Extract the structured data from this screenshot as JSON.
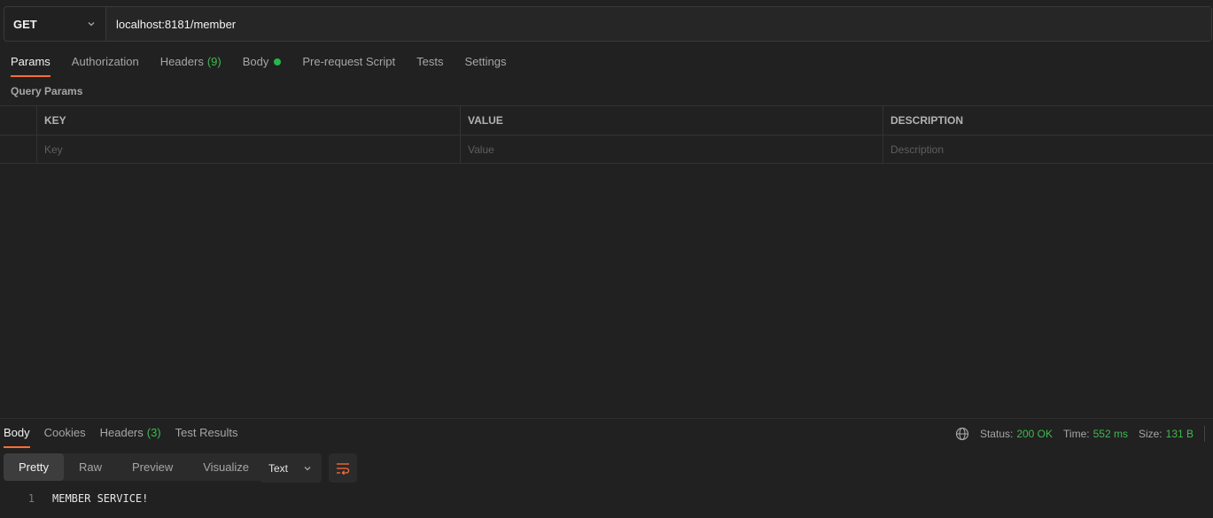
{
  "request": {
    "method": "GET",
    "url": "localhost:8181/member"
  },
  "request_tabs": [
    {
      "label": "Params"
    },
    {
      "label": "Authorization"
    },
    {
      "label": "Headers",
      "count": "(9)"
    },
    {
      "label": "Body"
    },
    {
      "label": "Pre-request Script"
    },
    {
      "label": "Tests"
    },
    {
      "label": "Settings"
    }
  ],
  "query_params": {
    "title": "Query Params",
    "headers": {
      "key": "KEY",
      "value": "VALUE",
      "description": "DESCRIPTION"
    },
    "placeholders": {
      "key": "Key",
      "value": "Value",
      "description": "Description"
    }
  },
  "response_tabs": [
    {
      "label": "Body"
    },
    {
      "label": "Cookies"
    },
    {
      "label": "Headers",
      "count": "(3)"
    },
    {
      "label": "Test Results"
    }
  ],
  "status": {
    "status_label": "Status:",
    "status_value": "200 OK",
    "time_label": "Time:",
    "time_value": "552 ms",
    "size_label": "Size:",
    "size_value": "131 B"
  },
  "view_modes": [
    "Pretty",
    "Raw",
    "Preview",
    "Visualize"
  ],
  "format": "Text",
  "response_body": {
    "line_number": "1",
    "text": "MEMBER SERVICE!"
  },
  "colors": {
    "accent": "#ff6c37",
    "success": "#3fb950",
    "background": "#212121"
  },
  "icons": [
    "chevron-down-icon",
    "globe-icon",
    "wrap-lines-icon"
  ]
}
